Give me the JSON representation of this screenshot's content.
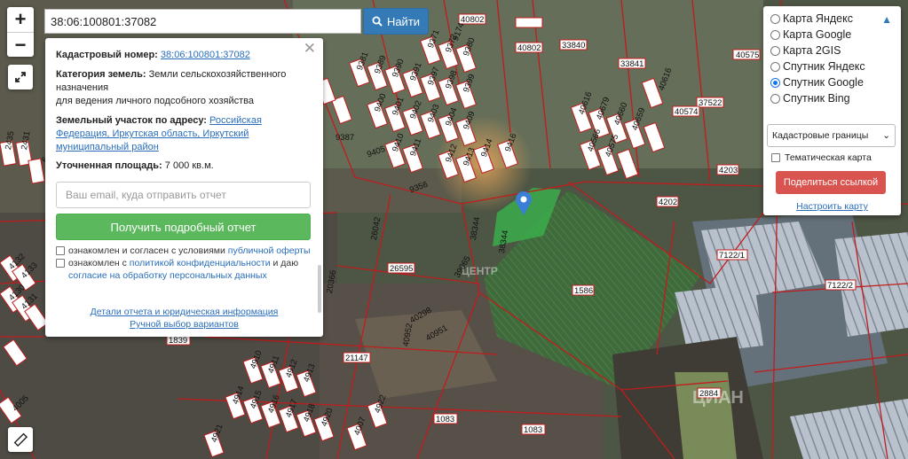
{
  "search": {
    "value": "38:06:100801:37082",
    "button_label": "Найти"
  },
  "zoom": {
    "in_label": "+",
    "out_label": "−"
  },
  "info_panel": {
    "cadastral_label": "Кадастровый номер:",
    "cadastral_value": "38:06:100801:37082",
    "category_label": "Категория земель:",
    "category_value_1": " Земли сельскохозяйственного назначения",
    "category_value_2": "для ведения личного подсобного хозяйства",
    "address_label": "Земельный участок по адресу:",
    "address_value": "Российская Федерация, Иркутская область, Иркутский муниципальный район",
    "area_label": "Уточненная площадь:",
    "area_value": " 7 000 кв.м.",
    "email_placeholder": "Ваш email, куда отправить отчет",
    "report_button": "Получить подробный отчет",
    "agree_1_prefix": "ознакомлен и согласен с условиями ",
    "agree_1_link": "публичной оферты",
    "agree_2_prefix": "ознакомлен с ",
    "agree_2_link": "политикой конфиденциальности",
    "agree_2_mid": " и даю ",
    "agree_2_link2": "согласие на обработку персональных данных",
    "details_link": "Детали отчета и юридическая информация",
    "manual_link": "Ручной выбор вариантов"
  },
  "layers": {
    "options": [
      "Карта Яндекс",
      "Карта Google",
      "Карта 2GIS",
      "Спутник Яндекс",
      "Спутник Google",
      "Спутник Bing"
    ],
    "selected": "Спутник Google",
    "select_value": "Кадастровые границы",
    "thematic_label": "Тематическая карта",
    "share_button": "Поделиться ссылкой",
    "fit_link": "Настроить карту"
  },
  "map_labels": [
    "40802",
    "40802",
    "33840",
    "40575",
    "33841",
    "37522",
    "40574",
    "40616",
    "4203",
    "4202",
    "7122/1",
    "7122/2",
    "1586",
    "26595",
    "21147",
    "2884",
    "1083",
    "1083",
    "1839",
    "38344",
    "38344",
    "39065",
    "40952",
    "40951",
    "40298",
    "26042",
    "20366",
    "9387",
    "9356",
    "9405",
    "9371",
    "9372",
    "9380",
    "9381",
    "9389",
    "9390",
    "9391",
    "9397",
    "9398",
    "9399",
    "9400",
    "9401",
    "9402",
    "9403",
    "9404",
    "9409",
    "9410",
    "9411",
    "9412",
    "9413",
    "9414",
    "9416",
    "9174",
    "40616",
    "40679",
    "40660",
    "40659",
    "40566",
    "40575",
    "6",
    "4132",
    "4133",
    "4130",
    "4131",
    "2435",
    "2431",
    "4910",
    "4911",
    "4912",
    "4913",
    "4914",
    "4915",
    "4916",
    "4917",
    "4918",
    "4920",
    "4921",
    "4922",
    "4007",
    "4005"
  ]
}
